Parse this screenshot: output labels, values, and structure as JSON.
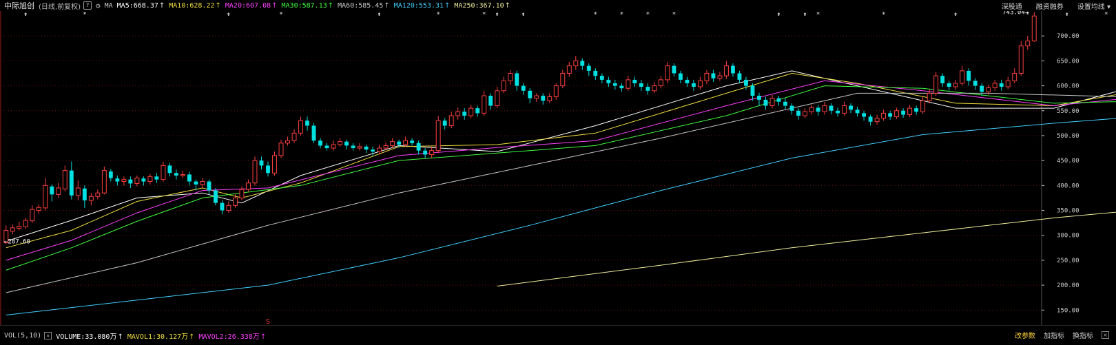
{
  "header": {
    "stock_name": "中际旭创",
    "adjust_note": "(日线,前复权)",
    "help": "?",
    "ma_label": "MA",
    "ma_items": [
      {
        "label": "MA5:668.37",
        "color": "#ffffff"
      },
      {
        "label": "MA10:628.22",
        "color": "#f0e040"
      },
      {
        "label": "MA20:607.08",
        "color": "#ff40ff"
      },
      {
        "label": "MA30:587.13",
        "color": "#40ff40"
      },
      {
        "label": "MA60:585.45",
        "color": "#c8c8c8"
      },
      {
        "label": "MA120:553.31",
        "color": "#40d0ff"
      },
      {
        "label": "MA250:367.10",
        "color": "#f0f0a0"
      }
    ],
    "arrow_glyph": "↑",
    "menu": [
      "深股通",
      "融资融券",
      "设置均线"
    ]
  },
  "footer": {
    "vol_label": "VOL(5,10)",
    "close": "×",
    "items": [
      {
        "label": "VOLUME:33.080万",
        "color": "#ffffff"
      },
      {
        "label": "MAVOL1:30.127万",
        "color": "#f0e040"
      },
      {
        "label": "MAVOL2:26.338万",
        "color": "#ff40ff"
      }
    ],
    "arrow_glyph": "↑",
    "buttons": [
      "改参数",
      "加指标",
      "换指标"
    ],
    "button_colors": [
      "#ffd23c",
      "#c8c8c8",
      "#c8c8c8"
    ]
  },
  "chart_data": {
    "type": "candlestick",
    "y_ticks": [
      "700.00",
      "650.00",
      "600.00",
      "550.00",
      "500.00",
      "450.00",
      "400.00",
      "350.00",
      "300.00",
      "250.00",
      "200.00",
      "150.00"
    ],
    "ylim": [
      120,
      750
    ],
    "annotations": {
      "high": "743.04",
      "low": "287.60",
      "marker": "S"
    },
    "colors": {
      "up": "#ff4040",
      "down": "#00e0e0",
      "grid": "#6a1010",
      "axis": "#d0d0d0"
    },
    "candles": [
      [
        285,
        310,
        320,
        283
      ],
      [
        308,
        315,
        322,
        302
      ],
      [
        314,
        318,
        327,
        310
      ],
      [
        317,
        330,
        335,
        313
      ],
      [
        329,
        352,
        360,
        325
      ],
      [
        350,
        356,
        362,
        343
      ],
      [
        355,
        400,
        415,
        350
      ],
      [
        398,
        382,
        402,
        368
      ],
      [
        382,
        395,
        405,
        375
      ],
      [
        393,
        430,
        440,
        388
      ],
      [
        430,
        380,
        448,
        372
      ],
      [
        380,
        395,
        410,
        370
      ],
      [
        394,
        370,
        400,
        355
      ],
      [
        370,
        378,
        385,
        360
      ],
      [
        378,
        385,
        392,
        372
      ],
      [
        385,
        430,
        438,
        382
      ],
      [
        428,
        415,
        433,
        408
      ],
      [
        414,
        408,
        420,
        400
      ],
      [
        408,
        412,
        418,
        400
      ],
      [
        412,
        404,
        418,
        395
      ],
      [
        404,
        415,
        420,
        398
      ],
      [
        414,
        408,
        418,
        400
      ],
      [
        408,
        418,
        423,
        402
      ],
      [
        418,
        412,
        425,
        405
      ],
      [
        412,
        440,
        448,
        408
      ],
      [
        440,
        425,
        445,
        418
      ],
      [
        425,
        420,
        432,
        412
      ],
      [
        420,
        422,
        430,
        415
      ],
      [
        422,
        408,
        428,
        400
      ],
      [
        408,
        402,
        412,
        390
      ],
      [
        402,
        408,
        415,
        395
      ],
      [
        408,
        390,
        412,
        382
      ],
      [
        390,
        365,
        395,
        360
      ],
      [
        365,
        350,
        370,
        342
      ],
      [
        350,
        360,
        368,
        345
      ],
      [
        360,
        375,
        382,
        355
      ],
      [
        375,
        392,
        398,
        370
      ],
      [
        392,
        405,
        412,
        388
      ],
      [
        405,
        450,
        458,
        400
      ],
      [
        450,
        440,
        458,
        432
      ],
      [
        440,
        425,
        448,
        418
      ],
      [
        425,
        460,
        468,
        420
      ],
      [
        460,
        485,
        492,
        455
      ],
      [
        485,
        490,
        498,
        480
      ],
      [
        490,
        505,
        513,
        485
      ],
      [
        505,
        530,
        538,
        500
      ],
      [
        530,
        520,
        538,
        510
      ],
      [
        520,
        490,
        525,
        485
      ],
      [
        490,
        480,
        495,
        475
      ],
      [
        480,
        475,
        485,
        470
      ],
      [
        475,
        482,
        490,
        470
      ],
      [
        482,
        488,
        495,
        478
      ],
      [
        488,
        480,
        492,
        472
      ],
      [
        480,
        475,
        485,
        470
      ],
      [
        475,
        478,
        485,
        470
      ],
      [
        478,
        472,
        482,
        465
      ],
      [
        472,
        468,
        478,
        460
      ],
      [
        468,
        475,
        482,
        462
      ],
      [
        475,
        480,
        486,
        470
      ],
      [
        480,
        488,
        495,
        475
      ],
      [
        488,
        482,
        492,
        476
      ],
      [
        482,
        490,
        498,
        478
      ],
      [
        490,
        485,
        495,
        480
      ],
      [
        485,
        470,
        490,
        462
      ],
      [
        470,
        462,
        475,
        455
      ],
      [
        462,
        470,
        478,
        455
      ],
      [
        470,
        530,
        540,
        465
      ],
      [
        530,
        520,
        535,
        512
      ],
      [
        520,
        540,
        548,
        515
      ],
      [
        540,
        548,
        556,
        532
      ],
      [
        548,
        540,
        555,
        532
      ],
      [
        540,
        555,
        562,
        535
      ],
      [
        555,
        545,
        560,
        538
      ],
      [
        545,
        580,
        590,
        540
      ],
      [
        580,
        560,
        585,
        552
      ],
      [
        560,
        590,
        598,
        555
      ],
      [
        590,
        610,
        618,
        585
      ],
      [
        610,
        625,
        632,
        602
      ],
      [
        625,
        600,
        630,
        590
      ],
      [
        600,
        590,
        605,
        582
      ],
      [
        590,
        575,
        595,
        565
      ],
      [
        575,
        580,
        585,
        568
      ],
      [
        580,
        570,
        585,
        562
      ],
      [
        570,
        578,
        585,
        566
      ],
      [
        578,
        600,
        605,
        572
      ],
      [
        600,
        625,
        632,
        595
      ],
      [
        625,
        640,
        648,
        618
      ],
      [
        640,
        650,
        660,
        632
      ],
      [
        650,
        640,
        655,
        632
      ],
      [
        640,
        630,
        645,
        620
      ],
      [
        630,
        620,
        635,
        612
      ],
      [
        620,
        612,
        625,
        605
      ],
      [
        612,
        605,
        618,
        598
      ],
      [
        605,
        600,
        612,
        592
      ],
      [
        600,
        595,
        605,
        588
      ],
      [
        595,
        612,
        620,
        590
      ],
      [
        612,
        605,
        618,
        598
      ],
      [
        605,
        598,
        612,
        590
      ],
      [
        598,
        590,
        605,
        582
      ],
      [
        590,
        600,
        608,
        585
      ],
      [
        600,
        612,
        620,
        595
      ],
      [
        612,
        640,
        648,
        605
      ],
      [
        640,
        625,
        645,
        618
      ],
      [
        625,
        612,
        630,
        605
      ],
      [
        612,
        605,
        618,
        598
      ],
      [
        605,
        598,
        612,
        590
      ],
      [
        598,
        610,
        618,
        592
      ],
      [
        610,
        625,
        632,
        603
      ],
      [
        625,
        615,
        632,
        608
      ],
      [
        615,
        620,
        628,
        610
      ],
      [
        620,
        640,
        650,
        614
      ],
      [
        640,
        625,
        645,
        618
      ],
      [
        625,
        612,
        630,
        605
      ],
      [
        612,
        600,
        618,
        592
      ],
      [
        600,
        580,
        605,
        570
      ],
      [
        580,
        572,
        586,
        560
      ],
      [
        572,
        560,
        578,
        552
      ],
      [
        560,
        575,
        582,
        555
      ],
      [
        575,
        568,
        580,
        560
      ],
      [
        568,
        560,
        575,
        552
      ],
      [
        560,
        550,
        565,
        542
      ],
      [
        550,
        540,
        555,
        532
      ],
      [
        540,
        548,
        555,
        535
      ],
      [
        548,
        556,
        562,
        542
      ],
      [
        556,
        548,
        562,
        540
      ],
      [
        548,
        560,
        568,
        542
      ],
      [
        560,
        550,
        565,
        543
      ],
      [
        550,
        545,
        556,
        538
      ],
      [
        545,
        560,
        568,
        540
      ],
      [
        560,
        552,
        565,
        545
      ],
      [
        552,
        545,
        558,
        538
      ],
      [
        545,
        538,
        550,
        530
      ],
      [
        538,
        528,
        542,
        520
      ],
      [
        528,
        535,
        542,
        522
      ],
      [
        535,
        545,
        552,
        530
      ],
      [
        545,
        538,
        550,
        532
      ],
      [
        538,
        550,
        556,
        533
      ],
      [
        550,
        542,
        555,
        536
      ],
      [
        542,
        555,
        562,
        537
      ],
      [
        555,
        548,
        560,
        542
      ],
      [
        548,
        570,
        578,
        544
      ],
      [
        570,
        585,
        592,
        565
      ],
      [
        585,
        620,
        628,
        580
      ],
      [
        620,
        605,
        625,
        598
      ],
      [
        605,
        598,
        610,
        590
      ],
      [
        598,
        605,
        612,
        592
      ],
      [
        605,
        630,
        640,
        600
      ],
      [
        630,
        610,
        635,
        600
      ],
      [
        610,
        600,
        615,
        592
      ],
      [
        600,
        588,
        605,
        580
      ],
      [
        588,
        596,
        602,
        582
      ],
      [
        596,
        605,
        612,
        590
      ],
      [
        605,
        598,
        612,
        590
      ],
      [
        598,
        610,
        618,
        593
      ],
      [
        610,
        625,
        635,
        605
      ],
      [
        625,
        680,
        690,
        620
      ],
      [
        680,
        690,
        700,
        672
      ],
      [
        690,
        740,
        748,
        688
      ]
    ],
    "ma_series": [
      {
        "name": "MA5",
        "color": "#ffffff",
        "pts": [
          [
            0,
            288
          ],
          [
            10,
            330
          ],
          [
            20,
            375
          ],
          [
            30,
            385
          ],
          [
            36,
            365
          ],
          [
            45,
            420
          ],
          [
            60,
            480
          ],
          [
            75,
            468
          ],
          [
            90,
            520
          ],
          [
            110,
            600
          ],
          [
            120,
            630
          ],
          [
            130,
            600
          ],
          [
            145,
            555
          ],
          [
            160,
            555
          ],
          [
            170,
            590
          ],
          [
            185,
            660
          ]
        ]
      },
      {
        "name": "MA10",
        "color": "#f0e040",
        "pts": [
          [
            0,
            275
          ],
          [
            10,
            310
          ],
          [
            20,
            368
          ],
          [
            30,
            395
          ],
          [
            36,
            375
          ],
          [
            45,
            405
          ],
          [
            60,
            478
          ],
          [
            75,
            482
          ],
          [
            90,
            505
          ],
          [
            110,
            585
          ],
          [
            120,
            625
          ],
          [
            130,
            605
          ],
          [
            145,
            565
          ],
          [
            160,
            560
          ],
          [
            175,
            595
          ],
          [
            185,
            625
          ]
        ]
      },
      {
        "name": "MA20",
        "color": "#ff40ff",
        "pts": [
          [
            0,
            250
          ],
          [
            10,
            290
          ],
          [
            20,
            345
          ],
          [
            30,
            390
          ],
          [
            40,
            395
          ],
          [
            60,
            460
          ],
          [
            75,
            476
          ],
          [
            90,
            490
          ],
          [
            110,
            560
          ],
          [
            125,
            610
          ],
          [
            140,
            590
          ],
          [
            160,
            560
          ],
          [
            175,
            580
          ],
          [
            185,
            603
          ]
        ]
      },
      {
        "name": "MA30",
        "color": "#40ff40",
        "pts": [
          [
            0,
            230
          ],
          [
            10,
            275
          ],
          [
            20,
            328
          ],
          [
            30,
            375
          ],
          [
            45,
            400
          ],
          [
            60,
            450
          ],
          [
            75,
            465
          ],
          [
            90,
            480
          ],
          [
            110,
            540
          ],
          [
            125,
            600
          ],
          [
            140,
            595
          ],
          [
            160,
            565
          ],
          [
            175,
            570
          ],
          [
            185,
            585
          ]
        ]
      },
      {
        "name": "MA60",
        "color": "#c8c8c8",
        "pts": [
          [
            0,
            185
          ],
          [
            20,
            245
          ],
          [
            40,
            320
          ],
          [
            60,
            385
          ],
          [
            80,
            440
          ],
          [
            100,
            495
          ],
          [
            120,
            555
          ],
          [
            130,
            585
          ],
          [
            150,
            585
          ],
          [
            170,
            578
          ],
          [
            185,
            583
          ]
        ]
      },
      {
        "name": "MA120",
        "color": "#40d0ff",
        "pts": [
          [
            0,
            140
          ],
          [
            40,
            200
          ],
          [
            60,
            255
          ],
          [
            80,
            320
          ],
          [
            100,
            390
          ],
          [
            120,
            455
          ],
          [
            140,
            502
          ],
          [
            160,
            525
          ],
          [
            185,
            550
          ]
        ]
      },
      {
        "name": "MA250",
        "color": "#f0f0a0",
        "pts": [
          [
            75,
            198
          ],
          [
            100,
            240
          ],
          [
            120,
            275
          ],
          [
            140,
            305
          ],
          [
            160,
            335
          ],
          [
            185,
            365
          ]
        ]
      }
    ],
    "markers": {
      "hash": [
        3,
        34,
        57,
        75,
        79,
        118,
        122,
        145,
        162,
        175,
        180
      ],
      "star": [
        12,
        42,
        66,
        73,
        90,
        94,
        98,
        102,
        124,
        134,
        156,
        168,
        177
      ]
    }
  }
}
